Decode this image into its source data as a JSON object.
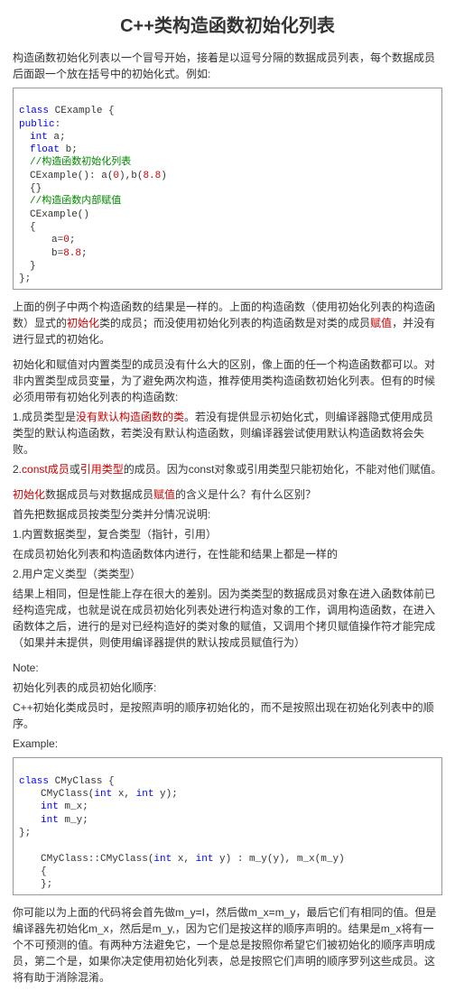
{
  "title": "C++类构造函数初始化列表",
  "intro": "构造函数初始化列表以一个冒号开始，接着是以逗号分隔的数据成员列表，每个数据成员后面跟一个放在括号中的初始化式。例如:",
  "code1": {
    "l1a": "class",
    "l1b": " CExample {",
    "l2a": "public",
    "l2b": ":",
    "l3a": "int",
    "l3b": " a;",
    "l4a": "float",
    "l4b": " b;",
    "l5": "//构造函数初始化列表",
    "l6a": "CExample(): a(",
    "l6b": "0",
    "l6c": "),b(",
    "l6d": "8.8",
    "l6e": ")",
    "l7": "{}",
    "l8": "//构造函数内部赋值",
    "l9": "CExample()",
    "l10": "{",
    "l11a": "a=",
    "l11b": "0",
    "l11c": ";",
    "l12a": "b=",
    "l12b": "8.8",
    "l12c": ";",
    "l13": "}",
    "l14": "};"
  },
  "p1a": "上面的例子中两个构造函数的结果是一样的。上面的构造函数（使用初始化列表的构造函数）显式的",
  "p1b": "初始化",
  "p1c": "类的成员；而没使用初始化列表的构造函数是对类的成员",
  "p1d": "赋值",
  "p1e": "，并没有进行显式的初始化。",
  "p2": "初始化和赋值对内置类型的成员没有什么大的区别，像上面的任一个构造函数都可以。对非内置类型成员变量，为了避免两次构造，推荐使用类构造函数初始化列表。但有的时候必须用带有初始化列表的构造函数:",
  "p3a": "1.成员类型是",
  "p3b": "没有默认构造函数的类",
  "p3c": "。若没有提供显示初始化式，则编译器隐式使用成员类型的默认构造函数，若类没有默认构造函数，则编译器尝试使用默认构造函数将会失败。",
  "p4a": "2.",
  "p4b": "const成员",
  "p4c": "或",
  "p4d": "引用类型",
  "p4e": "的成员。因为const对象或引用类型只能初始化，不能对他们赋值。",
  "p5a": "初始化",
  "p5b": "数据成员与对数据成员",
  "p5c": "赋值",
  "p5d": "的含义是什么？有什么区别？",
  "p6": "首先把数据成员按类型分类并分情况说明:",
  "p7": "1.内置数据类型，复合类型（指针，引用）",
  "p8": "    在成员初始化列表和构造函数体内进行，在性能和结果上都是一样的",
  "p9": "2.用户定义类型（类类型）",
  "p10": "    结果上相同，但是性能上存在很大的差别。因为类类型的数据成员对象在进入函数体前已经构造完成，也就是说在成员初始化列表处进行构造对象的工作，调用构造函数，在进入函数体之后，进行的是对已经构造好的类对象的赋值，又调用个拷贝赋值操作符才能完成（如果并未提供，则使用编译器提供的默认按成员赋值行为）",
  "note": "Note:",
  "p11": "初始化列表的成员初始化顺序:",
  "p12": "    C++初始化类成员时，是按照声明的顺序初始化的，而不是按照出现在初始化列表中的顺序。",
  "p13": "    Example:",
  "code2": {
    "l1a": "class",
    "l1b": " CMyClass {",
    "l2a": "CMyClass(",
    "l2b": "int",
    "l2c": " x, ",
    "l2d": "int",
    "l2e": " y);",
    "l3a": "int",
    "l3b": " m_x;",
    "l4a": "int",
    "l4b": " m_y;",
    "l5": "};",
    "l6": "",
    "l7a": "CMyClass::CMyClass(",
    "l7b": "int",
    "l7c": " x, ",
    "l7d": "int",
    "l7e": " y) : m_y(y), m_x(m_y)",
    "l8": "{",
    "l9": "};"
  },
  "p14": "你可能以为上面的代码将会首先做m_y=I，然后做m_x=m_y，最后它们有相同的值。但是编译器先初始化m_x，然后是m_y,，因为它们是按这样的顺序声明的。结果是m_x将有一个不可预测的值。有两种方法避免它，一个是总是按照你希望它们被初始化的顺序声明成员，第二个是，如果你决定使用初始化列表，总是按照它们声明的顺序罗列这些成员。这将有助于消除混淆。"
}
